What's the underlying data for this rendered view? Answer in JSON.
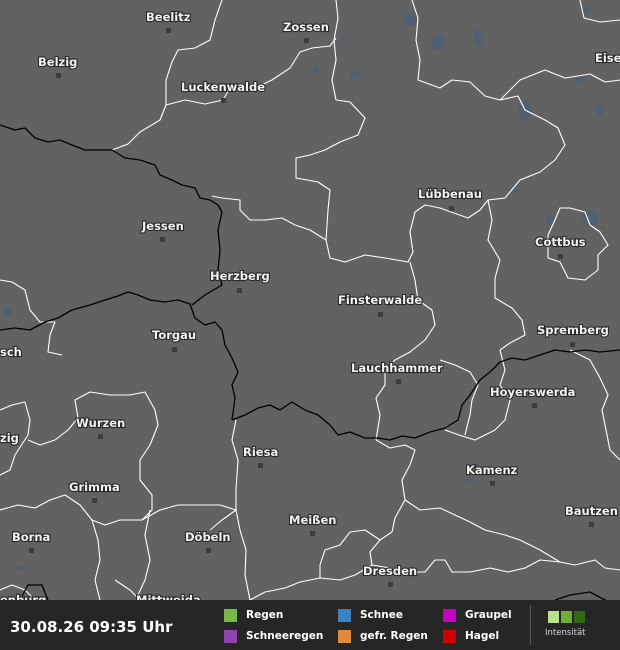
{
  "cities": [
    {
      "name": "Beelitz"
    },
    {
      "name": "Zossen"
    },
    {
      "name": "Eise"
    },
    {
      "name": "Belzig"
    },
    {
      "name": "Luckenwalde"
    },
    {
      "name": "Lübbenau"
    },
    {
      "name": "Jessen"
    },
    {
      "name": "Cottbus"
    },
    {
      "name": "Herzberg"
    },
    {
      "name": "Finsterwalde"
    },
    {
      "name": "Torgau"
    },
    {
      "name": "Spremberg"
    },
    {
      "name": "sch"
    },
    {
      "name": "Lauchhammer"
    },
    {
      "name": "Hoyerswerda"
    },
    {
      "name": "Wurzen"
    },
    {
      "name": "zig"
    },
    {
      "name": "Riesa"
    },
    {
      "name": "Kamenz"
    },
    {
      "name": "Grimma"
    },
    {
      "name": "Meißen"
    },
    {
      "name": "Bautzen"
    },
    {
      "name": "Borna"
    },
    {
      "name": "Döbeln"
    },
    {
      "name": "Dresden"
    },
    {
      "name": "enburg"
    },
    {
      "name": "Mittweida"
    }
  ],
  "legend": {
    "timestamp": "30.08.26 09:35 Uhr",
    "items": [
      {
        "label": "Regen",
        "color": "#7ab648"
      },
      {
        "label": "Schnee",
        "color": "#3b83bd"
      },
      {
        "label": "Graupel",
        "color": "#c400c4"
      },
      {
        "label": "Schneeregen",
        "color": "#8e44ad"
      },
      {
        "label": "gefr. Regen",
        "color": "#e08a3c"
      },
      {
        "label": "Hagel",
        "color": "#d10000"
      }
    ],
    "intensity_label": "Intensität",
    "intensity_colors": [
      "#b8e28c",
      "#6fae3d",
      "#2f6b13"
    ]
  },
  "colors": {
    "land": "#626262",
    "district_border": "#ffffff",
    "state_border": "#000000",
    "water": "#4f6073"
  }
}
